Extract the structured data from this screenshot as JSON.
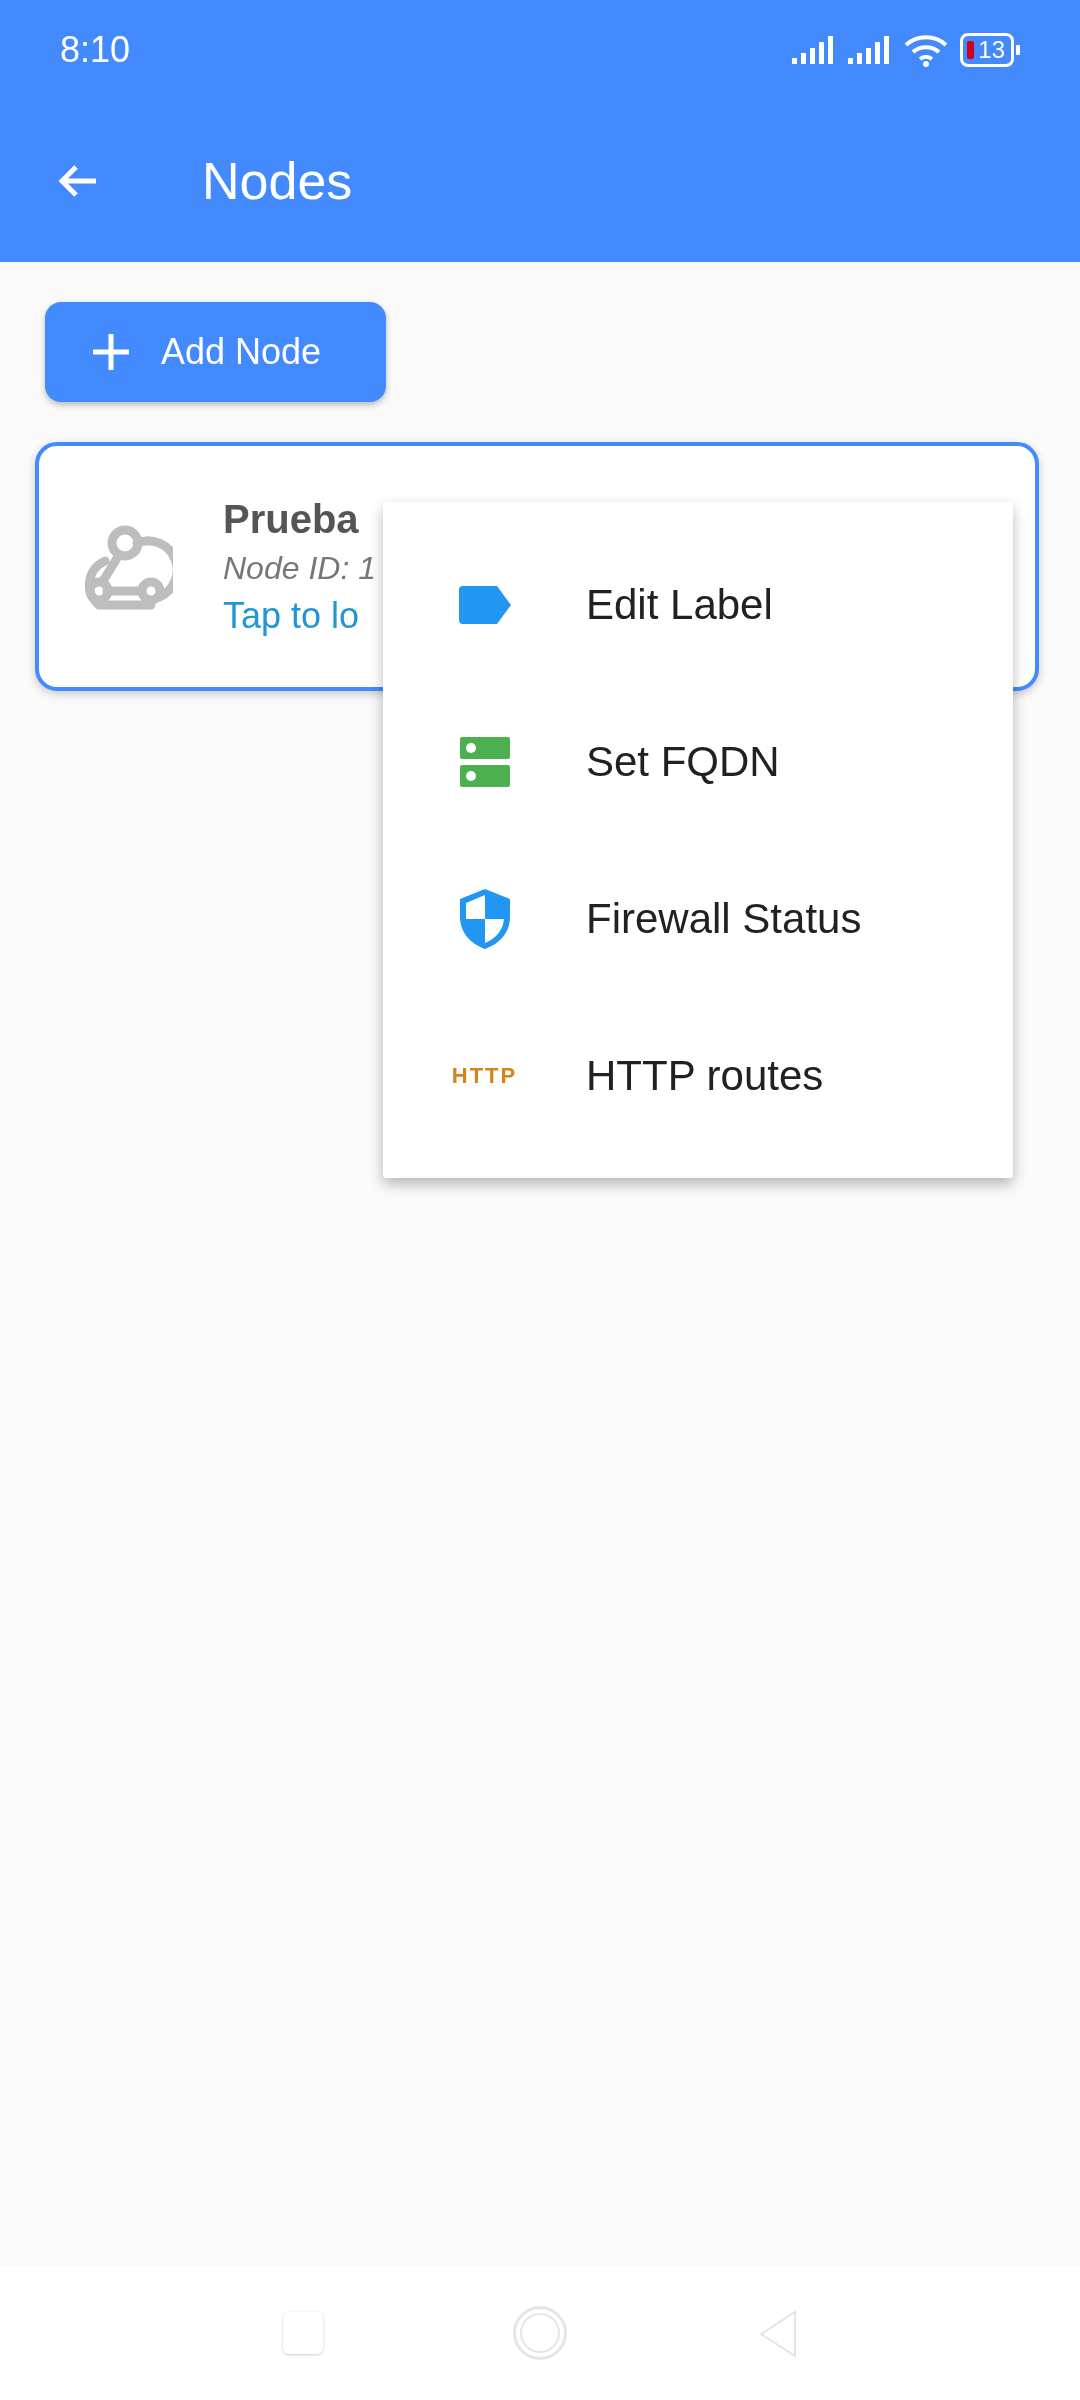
{
  "status_bar": {
    "time": "8:10",
    "battery": "13"
  },
  "app_bar": {
    "title": "Nodes"
  },
  "add_button": {
    "label": "Add Node"
  },
  "nodes": [
    {
      "name": "Prueba",
      "node_id": "Node ID: 1",
      "hint": "Tap to lo"
    }
  ],
  "menu": {
    "items": [
      {
        "kind": "label",
        "label": "Edit Label"
      },
      {
        "kind": "server",
        "label": "Set FQDN"
      },
      {
        "kind": "shield",
        "label": "Firewall Status"
      },
      {
        "kind": "http",
        "label": "HTTP routes",
        "icon_text": "HTTP"
      }
    ]
  }
}
